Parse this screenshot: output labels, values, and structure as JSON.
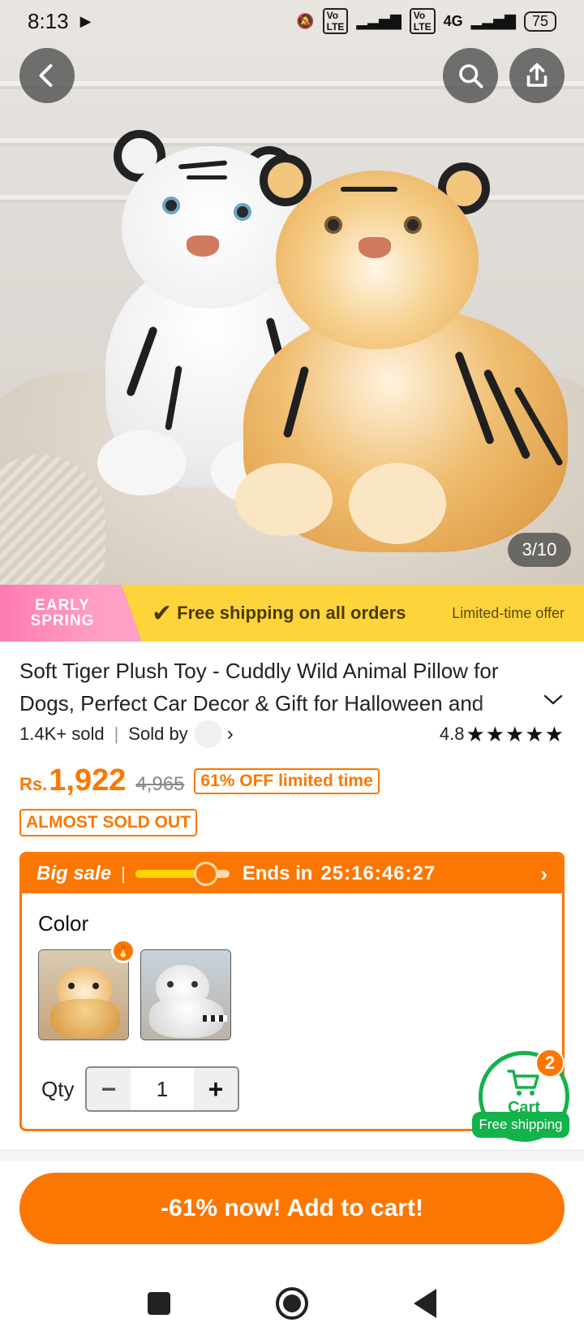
{
  "status_bar": {
    "time": "8:13",
    "network": "4G",
    "battery": "75"
  },
  "product_image": {
    "counter": "3/10"
  },
  "promo": {
    "badge": "EARLY SPRING",
    "free_shipping": "Free shipping on all orders",
    "limited": "Limited-time offer"
  },
  "product": {
    "title": "Soft Tiger Plush Toy - Cuddly Wild Animal Pillow for Dogs, Perfect Car Decor & Gift for Halloween and",
    "sold": "1.4K+ sold",
    "sold_by": "Sold by",
    "rating": "4.8",
    "stars": "★★★★★",
    "currency": "Rs.",
    "price": "1,922",
    "original_price": "4,965",
    "discount": "61% OFF limited time",
    "stock_badge": "ALMOST SOLD OUT"
  },
  "sale": {
    "label": "Big sale",
    "progress": 0.75,
    "ends_label": "Ends in",
    "timer": "25:16:46:27",
    "color_label": "Color",
    "qty_label": "Qty",
    "qty_value": "1",
    "colors": [
      {
        "name": "orange tiger"
      },
      {
        "name": "white tiger"
      }
    ]
  },
  "cart": {
    "label": "Cart",
    "count": "2",
    "free_shipping": "Free shipping"
  },
  "cta": {
    "label": "-61% now! Add to cart!"
  },
  "colors": {
    "accent": "#fb7701",
    "promo_yellow": "#ffd43b",
    "cart_green": "#13b24a"
  }
}
